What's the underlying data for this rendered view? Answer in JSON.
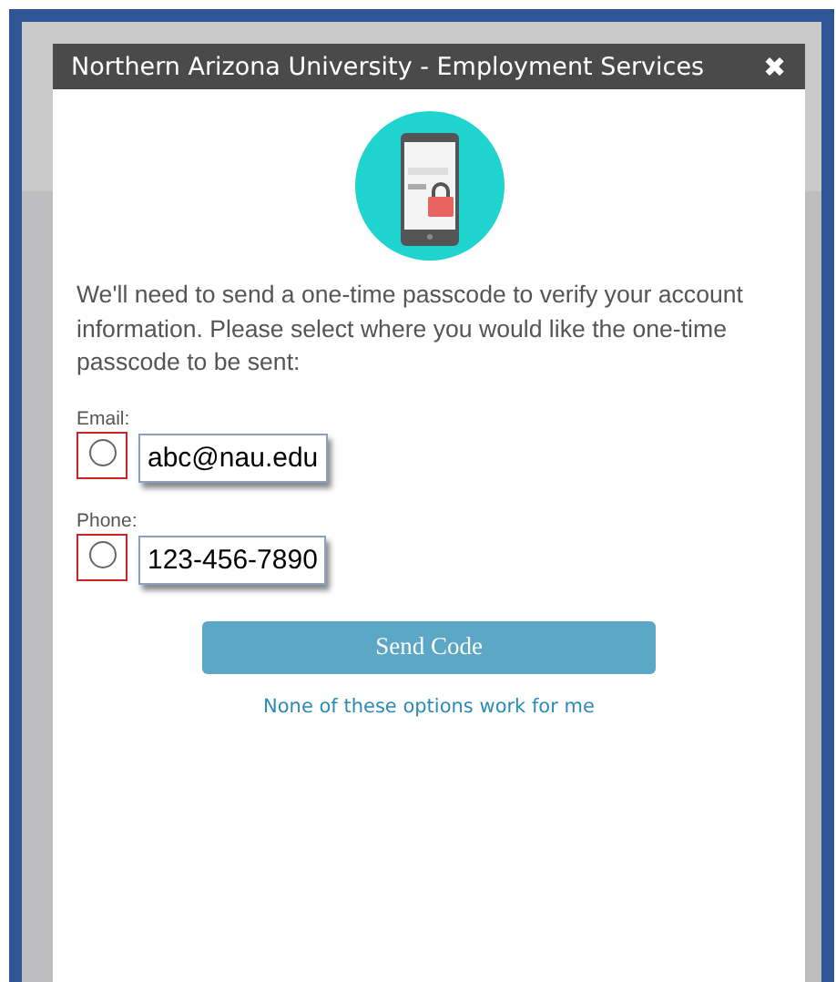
{
  "dialog": {
    "title": "Northern Arizona University - Employment Services",
    "close": "✖"
  },
  "message": "We'll need to send a one-time passcode to verify your account information. Please select where you would like the one-time passcode to be sent:",
  "options": [
    {
      "label": "Email:",
      "value": "abc@nau.edu",
      "selected": false
    },
    {
      "label": "Phone:",
      "value": "123-456-7890",
      "selected": false
    }
  ],
  "button": "Send Code",
  "link": "None of these options work for me"
}
